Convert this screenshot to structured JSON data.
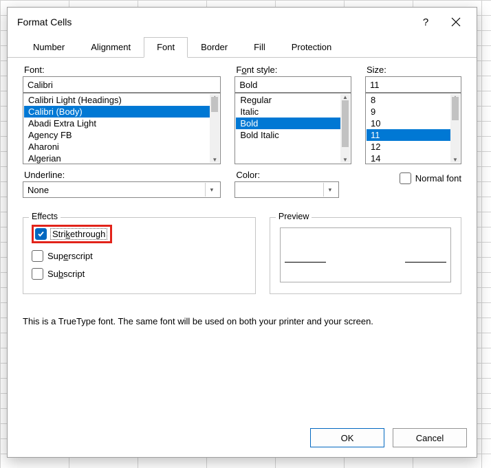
{
  "title": "Format Cells",
  "tabs": [
    "Number",
    "Alignment",
    "Font",
    "Border",
    "Fill",
    "Protection"
  ],
  "active_tab": 2,
  "font": {
    "label": "Font:",
    "value": "Calibri",
    "items": [
      "Calibri Light (Headings)",
      "Calibri (Body)",
      "Abadi Extra Light",
      "Agency FB",
      "Aharoni",
      "Algerian"
    ],
    "selected_index": 1
  },
  "font_style": {
    "label": "Font style:",
    "value": "Bold",
    "items": [
      "Regular",
      "Italic",
      "Bold",
      "Bold Italic"
    ],
    "selected_index": 2
  },
  "size": {
    "label": "Size:",
    "value": "11",
    "items": [
      "8",
      "9",
      "10",
      "11",
      "12",
      "14"
    ],
    "selected_index": 3
  },
  "underline": {
    "label": "Underline:",
    "value": "None"
  },
  "color": {
    "label": "Color:"
  },
  "normal_font": {
    "label": "Normal font",
    "checked": false
  },
  "effects": {
    "label": "Effects",
    "strikethrough": {
      "label": "Strikethrough",
      "checked": true
    },
    "superscript": {
      "label": "Superscript",
      "checked": false
    },
    "subscript": {
      "label": "Subscript",
      "checked": false
    }
  },
  "preview": {
    "label": "Preview"
  },
  "info": "This is a TrueType font.  The same font will be used on both your printer and your screen.",
  "buttons": {
    "ok": "OK",
    "cancel": "Cancel"
  }
}
